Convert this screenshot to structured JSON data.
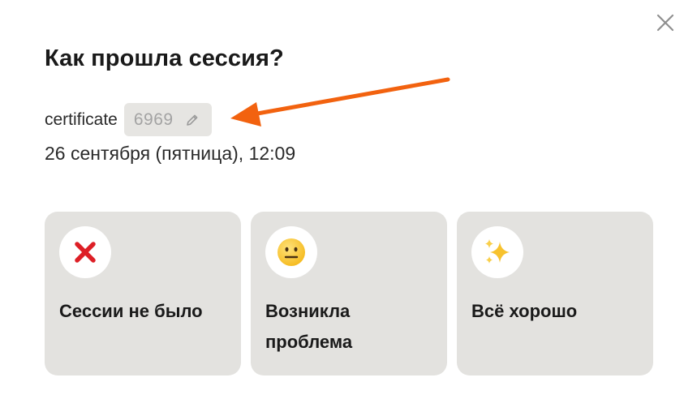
{
  "dialog": {
    "title": "Как прошла сессия?"
  },
  "certificate": {
    "label": "certificate",
    "value": "6969"
  },
  "session": {
    "date": "26 сентября (пятница), 12:09"
  },
  "options": [
    {
      "label_lines": [
        "Сессии не было"
      ],
      "icon": "red-cross-icon"
    },
    {
      "label_lines": [
        "Возникла",
        "проблема"
      ],
      "icon": "neutral-face-icon"
    },
    {
      "label_lines": [
        "Всё хорошо"
      ],
      "icon": "sparkles-icon"
    }
  ],
  "colors": {
    "annotation_arrow": "#f2620f",
    "card_background": "#e3e2df",
    "field_background": "#e6e5e2"
  }
}
